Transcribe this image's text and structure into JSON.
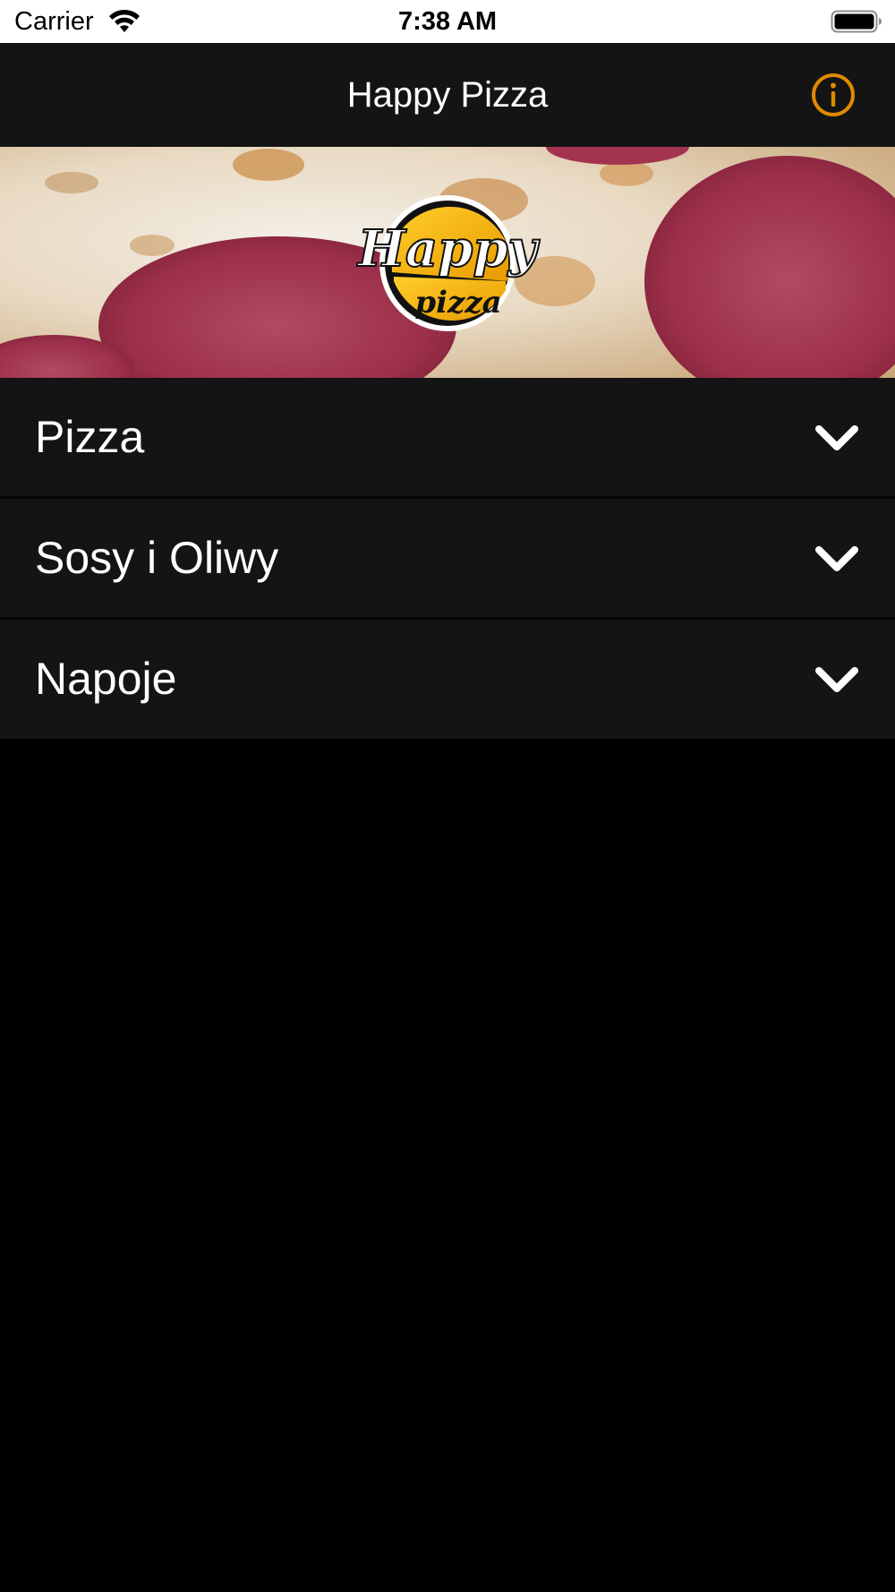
{
  "status_bar": {
    "carrier": "Carrier",
    "time": "7:38 AM"
  },
  "nav": {
    "title": "Happy Pizza",
    "info_icon": "info-circle-icon",
    "accent_color": "#E08A00"
  },
  "banner": {
    "logo_text_top": "Happy",
    "logo_text_bottom": "pizza"
  },
  "categories": [
    {
      "label": "Pizza",
      "icon": "chevron-down-icon"
    },
    {
      "label": "Sosy i Oliwy",
      "icon": "chevron-down-icon"
    },
    {
      "label": "Napoje",
      "icon": "chevron-down-icon"
    }
  ]
}
